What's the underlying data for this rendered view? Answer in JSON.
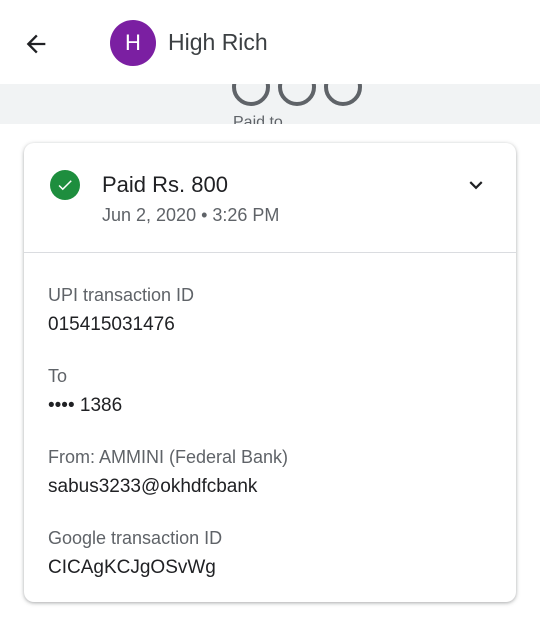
{
  "header": {
    "contact_name": "High Rich",
    "avatar_initial": "H",
    "avatar_color": "#7b1fa2"
  },
  "background": {
    "partial_text": "Paid to"
  },
  "transaction": {
    "title": "Paid Rs. 800",
    "datetime": "Jun 2, 2020 • 3:26 PM",
    "status_color": "#1e8e3e",
    "details": [
      {
        "label": "UPI transaction ID",
        "value": "015415031476"
      },
      {
        "label": "To",
        "value": "•••• 1386"
      },
      {
        "label": "From: AMMINI (Federal Bank)",
        "value": "sabus3233@okhdfcbank"
      },
      {
        "label": "Google transaction ID",
        "value": "CICAgKCJgOSvWg"
      }
    ]
  }
}
